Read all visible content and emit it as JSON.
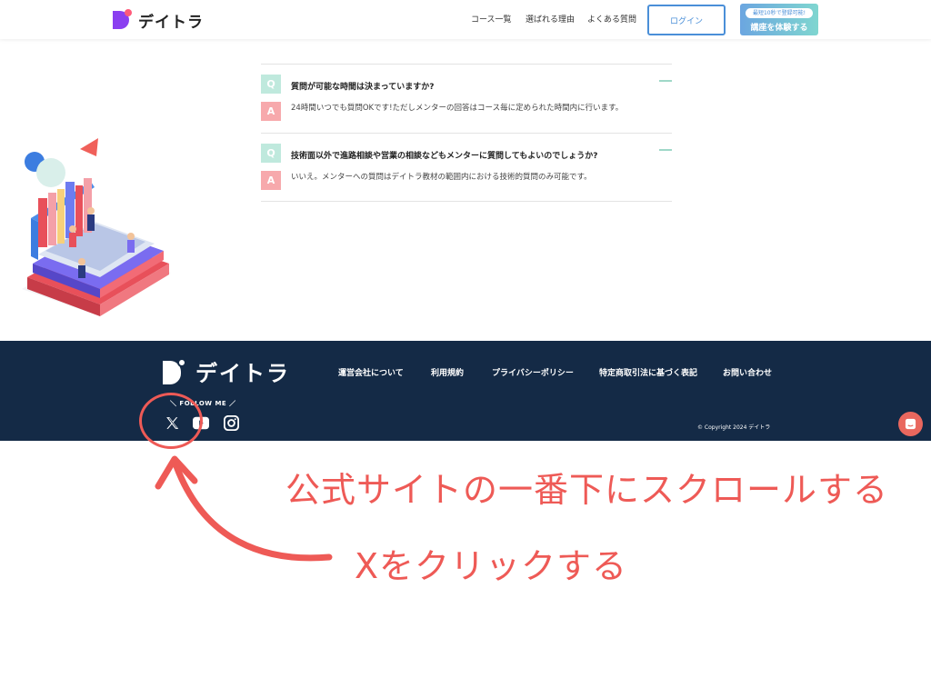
{
  "header": {
    "logo_text": "デイトラ",
    "nav": [
      "コース一覧",
      "選ばれる理由",
      "よくある質問"
    ],
    "login_label": "ログイン",
    "trial_badge": "最短10秒で登録可能!",
    "trial_label": "講座を体験する"
  },
  "faq": {
    "items": [
      {
        "q_mark": "Q",
        "question": "質問が可能な時間は決まっていますか?",
        "a_mark": "A",
        "answer": "24時間いつでも質問OKです!ただしメンターの回答はコース毎に定められた時間内に行います。"
      },
      {
        "q_mark": "Q",
        "question": "技術面以外で進路相談や営業の相談などもメンターに質問してもよいのでしょうか?",
        "a_mark": "A",
        "answer": "いいえ。メンターへの質問はデイトラ教材の範囲内における技術的質問のみ可能です。"
      }
    ]
  },
  "footer": {
    "logo_text": "デイトラ",
    "links": [
      "運営会社について",
      "利用規約",
      "プライバシーポリシー",
      "特定商取引法に基づく表記",
      "お問い合わせ"
    ],
    "follow_label": "＼ FOLLOW ME ／",
    "sns": [
      "x-icon",
      "youtube-icon",
      "instagram-icon"
    ],
    "copyright": "© Copyright 2024 デイトラ"
  },
  "annotations": {
    "step1": "公式サイトの一番下にスクロールする",
    "step2": "Xをクリックする"
  },
  "colors": {
    "accent_purple": "#8a3ff0",
    "footer_bg": "#142a46",
    "annotation_red": "#ee5a56",
    "q_mint": "#bfe9dd",
    "a_pink": "#f7a9ac"
  }
}
